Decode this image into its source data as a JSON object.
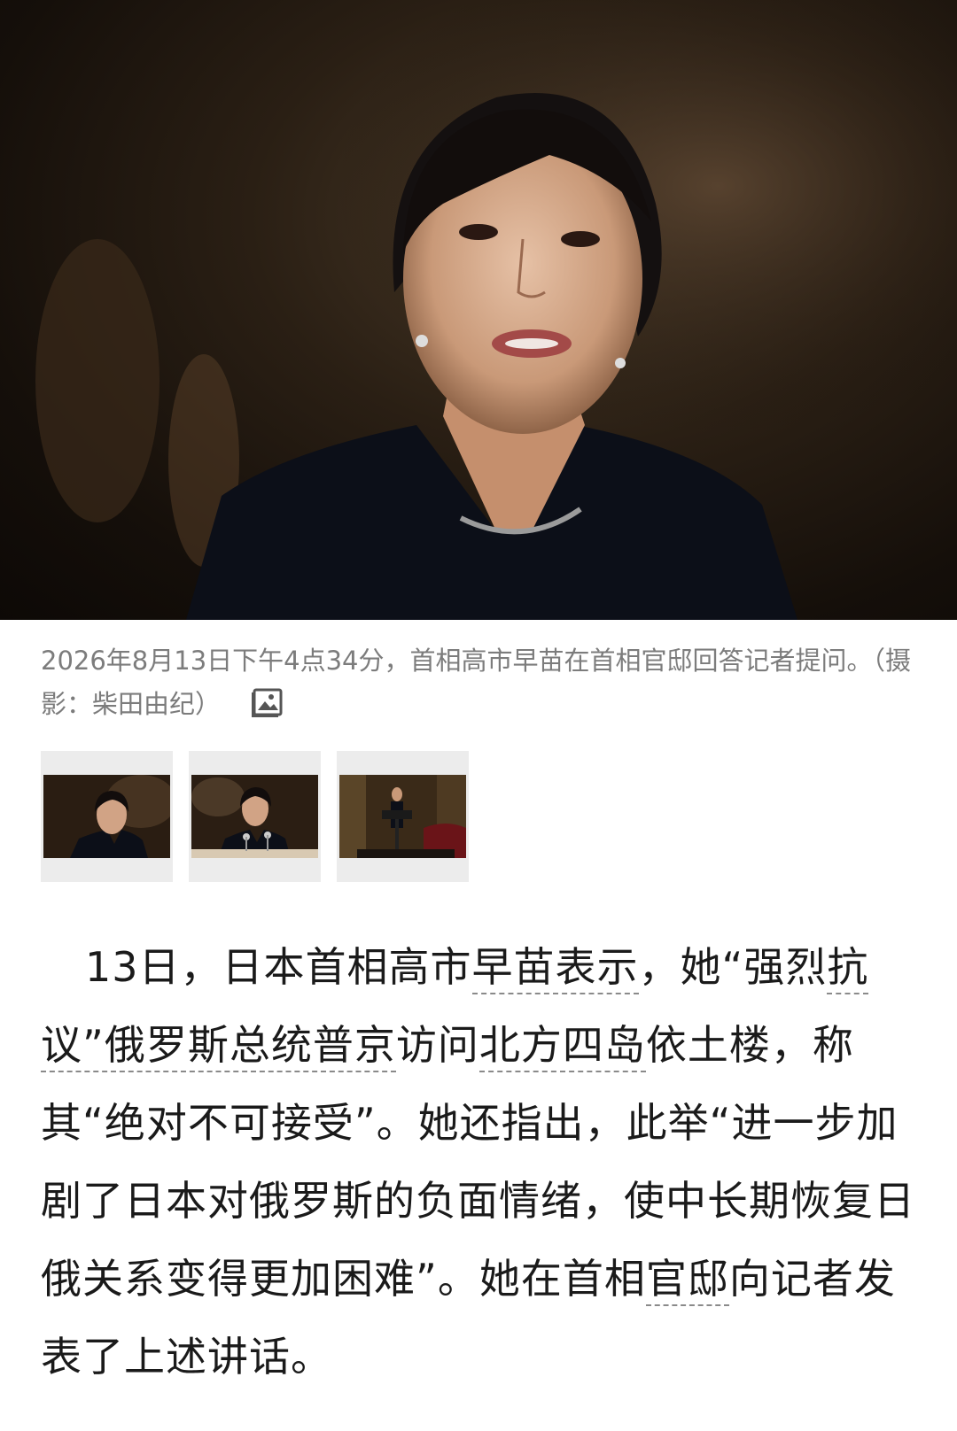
{
  "hero": {
    "image_icon": "portrait-photo"
  },
  "caption": {
    "text": "2026年8月13日下午4点34分，首相高市早苗在首相官邸回答记者提问。（摄影：柴田由纪）",
    "gallery_icon": "gallery-icon"
  },
  "thumbnails": [
    {
      "icon": "thumbnail-portrait"
    },
    {
      "icon": "thumbnail-microphones"
    },
    {
      "icon": "thumbnail-podium"
    }
  ],
  "article": {
    "seg1": "13日，日本首相高市",
    "link1": "早苗表示",
    "seg2": "，她“强烈",
    "link2": "抗议”俄罗斯总统普京",
    "seg3": "访问",
    "link3": "北方四岛",
    "seg4": "依土楼，称其“绝对不可接受”。她还指出，此举“进一步加剧了日本对俄罗斯的负面情绪，使中长期恢复日俄关系变得更加困难”。她在首相",
    "link4": "官邸",
    "seg5": "向记者发表了上述讲话。"
  }
}
